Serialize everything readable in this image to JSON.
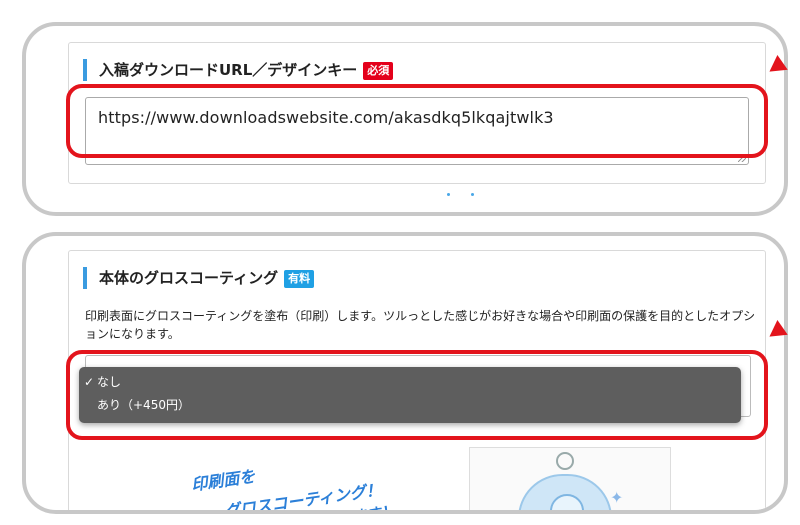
{
  "section1": {
    "title": "入稿ダウンロードURL／デザインキー",
    "badge": "必須",
    "textarea_value": "https://www.downloadswebsite.com/akasdkq5lkqajtwlk3"
  },
  "section2": {
    "title": "本体のグロスコーティング",
    "badge": "有料",
    "description": "印刷表面にグロスコーティングを塗布（印刷）します。ツルっとした感じがお好きな場合や印刷面の保護を目的としたオプションになります。",
    "dropdown": {
      "options": [
        {
          "label": "なし",
          "selected": true
        },
        {
          "label": "あり（+450円）",
          "selected": false
        }
      ],
      "check_glyph": "✓"
    },
    "preview_text": {
      "line1": "印刷面を",
      "line2": "グロスコーティング！",
      "line3": "ます！"
    }
  },
  "colors": {
    "highlight": "#e3141c",
    "required_badge": "#e4001b",
    "paid_badge": "#1fa0e4",
    "title_bar": "#3a9be0",
    "dropdown_bg": "#5e5e5e"
  }
}
